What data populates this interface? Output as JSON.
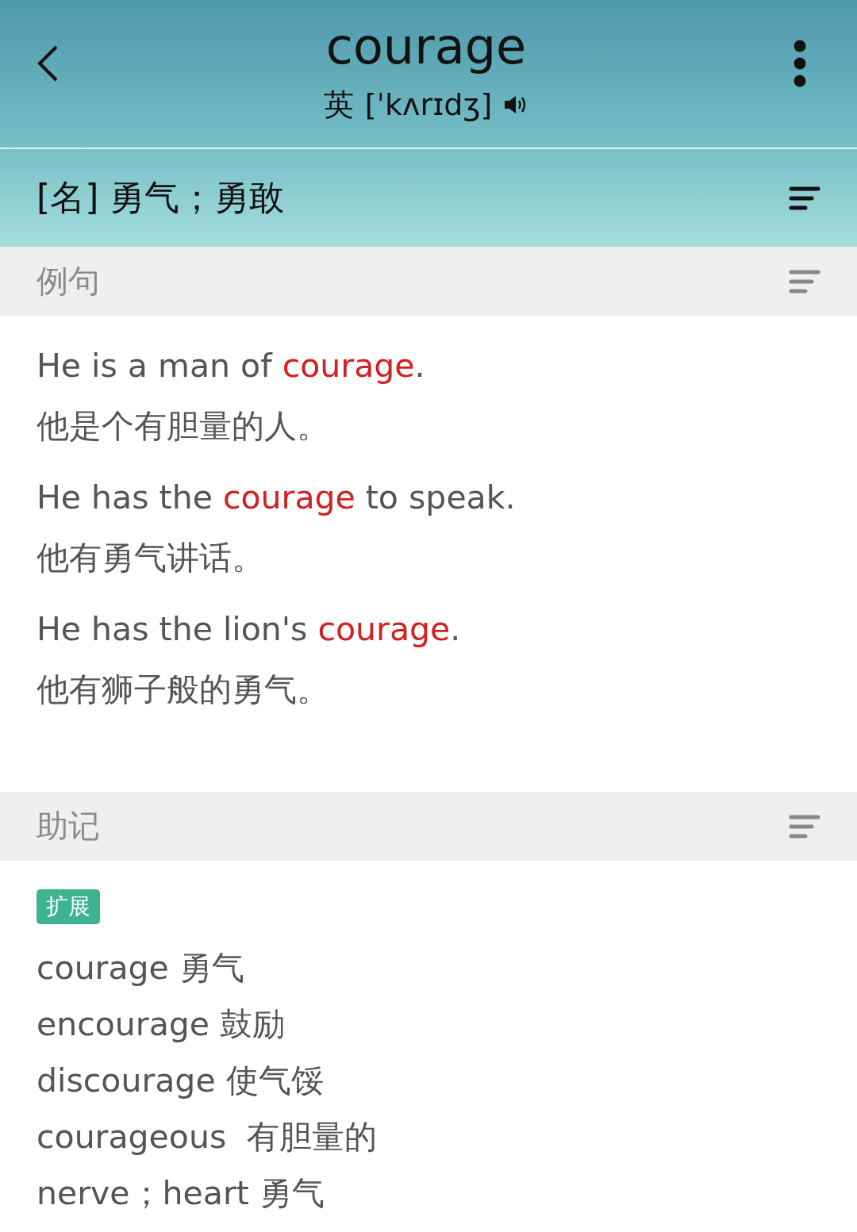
{
  "header": {
    "word": "courage",
    "accent": "英",
    "phonetic": "[ˈkʌrɪdʒ]"
  },
  "definition": "[名] 勇气；勇敢",
  "sections": [
    {
      "title": "例句",
      "kind": "examples",
      "examples": [
        {
          "before": "He is a man of ",
          "highlight": "courage",
          "after": ".",
          "translation": "他是个有胆量的人。"
        },
        {
          "before": "He has the ",
          "highlight": "courage",
          "after": " to speak.",
          "translation": "他有勇气讲话。"
        },
        {
          "before": "He has the lion's ",
          "highlight": "courage",
          "after": ".",
          "translation": "他有狮子般的勇气。"
        }
      ]
    },
    {
      "title": "助记",
      "kind": "mnemonic",
      "tag": "扩展",
      "lines": [
        "courage 勇气",
        "encourage 鼓励",
        "discourage 使气馁",
        "courageous  有胆量的",
        "nerve；heart 勇气"
      ]
    }
  ]
}
